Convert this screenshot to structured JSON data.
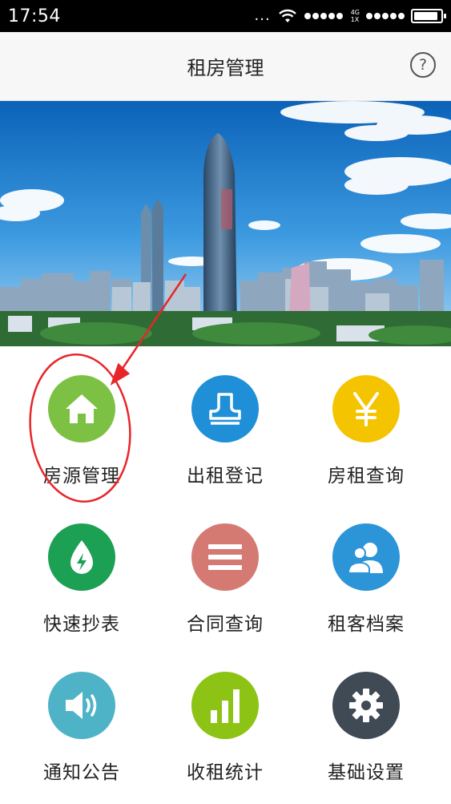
{
  "status_bar": {
    "time": "17:54",
    "dots": "...",
    "network_top": "4G",
    "network_bottom": "1X",
    "battery_level": 0.9
  },
  "header": {
    "title": "租房管理",
    "help_glyph": "?"
  },
  "banner": {
    "icon": "city-skyline-image"
  },
  "menu": {
    "items": [
      {
        "label": "房源管理",
        "icon": "home-icon",
        "color": "#7dc144"
      },
      {
        "label": "出租登记",
        "icon": "stamp-icon",
        "color": "#1f8fd8"
      },
      {
        "label": "房租查询",
        "icon": "yen-icon",
        "color": "#f5c400"
      },
      {
        "label": "快速抄表",
        "icon": "meter-drop-icon",
        "color": "#1ca053"
      },
      {
        "label": "合同查询",
        "icon": "list-icon",
        "color": "#d47a73"
      },
      {
        "label": "租客档案",
        "icon": "users-icon",
        "color": "#2c95d8"
      },
      {
        "label": "通知公告",
        "icon": "speaker-icon",
        "color": "#4fb3c8"
      },
      {
        "label": "收租统计",
        "icon": "bar-chart-icon",
        "color": "#8cc314"
      },
      {
        "label": "基础设置",
        "icon": "gear-icon",
        "color": "#3f4a55"
      }
    ]
  },
  "annotation": {
    "color": "#e8262a"
  }
}
